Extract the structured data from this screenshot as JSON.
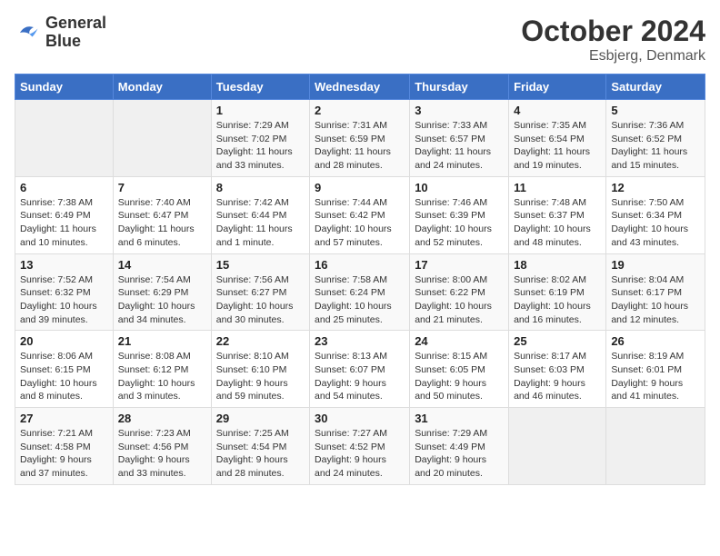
{
  "header": {
    "logo_line1": "General",
    "logo_line2": "Blue",
    "month": "October 2024",
    "location": "Esbjerg, Denmark"
  },
  "weekdays": [
    "Sunday",
    "Monday",
    "Tuesday",
    "Wednesday",
    "Thursday",
    "Friday",
    "Saturday"
  ],
  "weeks": [
    [
      {
        "day": "",
        "info": ""
      },
      {
        "day": "",
        "info": ""
      },
      {
        "day": "1",
        "info": "Sunrise: 7:29 AM\nSunset: 7:02 PM\nDaylight: 11 hours\nand 33 minutes."
      },
      {
        "day": "2",
        "info": "Sunrise: 7:31 AM\nSunset: 6:59 PM\nDaylight: 11 hours\nand 28 minutes."
      },
      {
        "day": "3",
        "info": "Sunrise: 7:33 AM\nSunset: 6:57 PM\nDaylight: 11 hours\nand 24 minutes."
      },
      {
        "day": "4",
        "info": "Sunrise: 7:35 AM\nSunset: 6:54 PM\nDaylight: 11 hours\nand 19 minutes."
      },
      {
        "day": "5",
        "info": "Sunrise: 7:36 AM\nSunset: 6:52 PM\nDaylight: 11 hours\nand 15 minutes."
      }
    ],
    [
      {
        "day": "6",
        "info": "Sunrise: 7:38 AM\nSunset: 6:49 PM\nDaylight: 11 hours\nand 10 minutes."
      },
      {
        "day": "7",
        "info": "Sunrise: 7:40 AM\nSunset: 6:47 PM\nDaylight: 11 hours\nand 6 minutes."
      },
      {
        "day": "8",
        "info": "Sunrise: 7:42 AM\nSunset: 6:44 PM\nDaylight: 11 hours\nand 1 minute."
      },
      {
        "day": "9",
        "info": "Sunrise: 7:44 AM\nSunset: 6:42 PM\nDaylight: 10 hours\nand 57 minutes."
      },
      {
        "day": "10",
        "info": "Sunrise: 7:46 AM\nSunset: 6:39 PM\nDaylight: 10 hours\nand 52 minutes."
      },
      {
        "day": "11",
        "info": "Sunrise: 7:48 AM\nSunset: 6:37 PM\nDaylight: 10 hours\nand 48 minutes."
      },
      {
        "day": "12",
        "info": "Sunrise: 7:50 AM\nSunset: 6:34 PM\nDaylight: 10 hours\nand 43 minutes."
      }
    ],
    [
      {
        "day": "13",
        "info": "Sunrise: 7:52 AM\nSunset: 6:32 PM\nDaylight: 10 hours\nand 39 minutes."
      },
      {
        "day": "14",
        "info": "Sunrise: 7:54 AM\nSunset: 6:29 PM\nDaylight: 10 hours\nand 34 minutes."
      },
      {
        "day": "15",
        "info": "Sunrise: 7:56 AM\nSunset: 6:27 PM\nDaylight: 10 hours\nand 30 minutes."
      },
      {
        "day": "16",
        "info": "Sunrise: 7:58 AM\nSunset: 6:24 PM\nDaylight: 10 hours\nand 25 minutes."
      },
      {
        "day": "17",
        "info": "Sunrise: 8:00 AM\nSunset: 6:22 PM\nDaylight: 10 hours\nand 21 minutes."
      },
      {
        "day": "18",
        "info": "Sunrise: 8:02 AM\nSunset: 6:19 PM\nDaylight: 10 hours\nand 16 minutes."
      },
      {
        "day": "19",
        "info": "Sunrise: 8:04 AM\nSunset: 6:17 PM\nDaylight: 10 hours\nand 12 minutes."
      }
    ],
    [
      {
        "day": "20",
        "info": "Sunrise: 8:06 AM\nSunset: 6:15 PM\nDaylight: 10 hours\nand 8 minutes."
      },
      {
        "day": "21",
        "info": "Sunrise: 8:08 AM\nSunset: 6:12 PM\nDaylight: 10 hours\nand 3 minutes."
      },
      {
        "day": "22",
        "info": "Sunrise: 8:10 AM\nSunset: 6:10 PM\nDaylight: 9 hours\nand 59 minutes."
      },
      {
        "day": "23",
        "info": "Sunrise: 8:13 AM\nSunset: 6:07 PM\nDaylight: 9 hours\nand 54 minutes."
      },
      {
        "day": "24",
        "info": "Sunrise: 8:15 AM\nSunset: 6:05 PM\nDaylight: 9 hours\nand 50 minutes."
      },
      {
        "day": "25",
        "info": "Sunrise: 8:17 AM\nSunset: 6:03 PM\nDaylight: 9 hours\nand 46 minutes."
      },
      {
        "day": "26",
        "info": "Sunrise: 8:19 AM\nSunset: 6:01 PM\nDaylight: 9 hours\nand 41 minutes."
      }
    ],
    [
      {
        "day": "27",
        "info": "Sunrise: 7:21 AM\nSunset: 4:58 PM\nDaylight: 9 hours\nand 37 minutes."
      },
      {
        "day": "28",
        "info": "Sunrise: 7:23 AM\nSunset: 4:56 PM\nDaylight: 9 hours\nand 33 minutes."
      },
      {
        "day": "29",
        "info": "Sunrise: 7:25 AM\nSunset: 4:54 PM\nDaylight: 9 hours\nand 28 minutes."
      },
      {
        "day": "30",
        "info": "Sunrise: 7:27 AM\nSunset: 4:52 PM\nDaylight: 9 hours\nand 24 minutes."
      },
      {
        "day": "31",
        "info": "Sunrise: 7:29 AM\nSunset: 4:49 PM\nDaylight: 9 hours\nand 20 minutes."
      },
      {
        "day": "",
        "info": ""
      },
      {
        "day": "",
        "info": ""
      }
    ]
  ]
}
